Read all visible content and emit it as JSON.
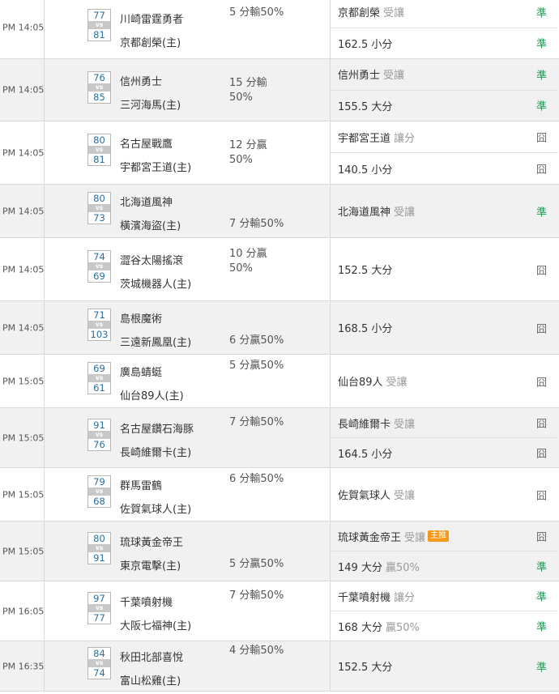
{
  "games": [
    {
      "time": "PM 14:05",
      "away": "川崎雷霆勇者",
      "home": "京都創榮(主)",
      "away_score": "77",
      "home_score": "81",
      "vs": "vs",
      "handicap": "5 分輸50%",
      "handicap_pos": "top",
      "picks": [
        {
          "main": "京都創榮",
          "tag": "受讓",
          "result": "準",
          "status": "win"
        },
        {
          "main": "162.5 小分",
          "tag": "",
          "result": "準",
          "status": "win"
        }
      ]
    },
    {
      "time": "PM 14:05",
      "away": "信州勇士",
      "home": "三河海馬(主)",
      "away_score": "76",
      "home_score": "85",
      "vs": "vs",
      "handicap": "15 分輸\n50%",
      "handicap_pos": "mid",
      "picks": [
        {
          "main": "信州勇士",
          "tag": "受讓",
          "result": "準",
          "status": "win"
        },
        {
          "main": "155.5 大分",
          "tag": "",
          "result": "準",
          "status": "win"
        }
      ]
    },
    {
      "time": "PM 14:05",
      "away": "名古屋戰鷹",
      "home": "宇都宮王道(主)",
      "away_score": "80",
      "home_score": "81",
      "vs": "vs",
      "handicap": "12 分贏\n50%",
      "handicap_pos": "mid",
      "picks": [
        {
          "main": "宇都宮王道",
          "tag": "讓分",
          "result": "囧",
          "status": "lose"
        },
        {
          "main": "140.5 小分",
          "tag": "",
          "result": "囧",
          "status": "lose"
        }
      ]
    },
    {
      "time": "PM 14:05",
      "away": "北海道風神",
      "home": "橫濱海盜(主)",
      "away_score": "80",
      "home_score": "73",
      "vs": "vs",
      "handicap": "7 分輸50%",
      "handicap_pos": "bottom",
      "picks": [
        {
          "main": "北海道風神",
          "tag": "受讓",
          "result": "準",
          "status": "win"
        }
      ]
    },
    {
      "time": "PM 14:05",
      "away": "澀谷太陽搖滾",
      "home": "茨城機器人(主)",
      "away_score": "74",
      "home_score": "69",
      "vs": "vs",
      "handicap": "10 分贏\n50%",
      "handicap_pos": "top",
      "picks": [
        {
          "main": "152.5 大分",
          "tag": "",
          "result": "囧",
          "status": "lose"
        }
      ]
    },
    {
      "time": "PM 14:05",
      "away": "島根魔術",
      "home": "三遠新鳳凰(主)",
      "away_score": "71",
      "home_score": "103",
      "vs": "vs",
      "handicap": "6 分贏50%",
      "handicap_pos": "bottom",
      "picks": [
        {
          "main": "168.5 小分",
          "tag": "",
          "result": "囧",
          "status": "lose"
        }
      ]
    },
    {
      "time": "PM 15:05",
      "away": "廣島蜻蜓",
      "home": "仙台89人(主)",
      "away_score": "69",
      "home_score": "61",
      "vs": "vs",
      "handicap": "5 分贏50%",
      "handicap_pos": "top",
      "picks": [
        {
          "main": "仙台89人",
          "tag": "受讓",
          "result": "囧",
          "status": "lose"
        }
      ]
    },
    {
      "time": "PM 15:05",
      "away": "名古屋鑽石海豚",
      "home": "長崎維爾卡(主)",
      "away_score": "91",
      "home_score": "76",
      "vs": "vs",
      "handicap": "7 分輸50%",
      "handicap_pos": "top",
      "picks": [
        {
          "main": "長崎維爾卡",
          "tag": "受讓",
          "result": "囧",
          "status": "lose"
        },
        {
          "main": "164.5 小分",
          "tag": "",
          "result": "囧",
          "status": "lose"
        }
      ]
    },
    {
      "time": "PM 15:05",
      "away": "群馬雷鶴",
      "home": "佐賀氣球人(主)",
      "away_score": "79",
      "home_score": "68",
      "vs": "vs",
      "handicap": "6 分輸50%",
      "handicap_pos": "top",
      "picks": [
        {
          "main": "佐賀氣球人",
          "tag": "受讓",
          "result": "囧",
          "status": "lose"
        }
      ]
    },
    {
      "time": "PM 15:05",
      "away": "琉球黃金帝王",
      "home": "東京電擊(主)",
      "away_score": "80",
      "home_score": "91",
      "vs": "vs",
      "handicap": "5 分贏50%",
      "handicap_pos": "bottom",
      "picks": [
        {
          "main": "琉球黃金帝王",
          "tag": "受讓",
          "badge": "主推",
          "result": "囧",
          "status": "lose"
        },
        {
          "main": "149 大分",
          "tag": "贏50%",
          "result": "準",
          "status": "win"
        }
      ]
    },
    {
      "time": "PM 16:05",
      "away": "千葉噴射機",
      "home": "大阪七福神(主)",
      "away_score": "97",
      "home_score": "77",
      "vs": "vs",
      "handicap": "7 分輸50%",
      "handicap_pos": "top",
      "picks": [
        {
          "main": "千葉噴射機",
          "tag": "讓分",
          "result": "準",
          "status": "win"
        },
        {
          "main": "168 大分",
          "tag": "贏50%",
          "result": "準",
          "status": "win"
        }
      ]
    },
    {
      "time": "PM 16:35",
      "away": "秋田北部喜悅",
      "home": "富山松雞(主)",
      "away_score": "84",
      "home_score": "74",
      "vs": "vs",
      "handicap": "4 分輸50%",
      "handicap_pos": "top",
      "picks": [
        {
          "main": "152.5 大分",
          "tag": "",
          "result": "準",
          "status": "win"
        }
      ]
    }
  ],
  "colors": {
    "win": "#1a9a52",
    "lose": "#666666",
    "score": "#2b6f9e",
    "badge": "#f39a1b",
    "alt_row": "#f1f1f1"
  }
}
